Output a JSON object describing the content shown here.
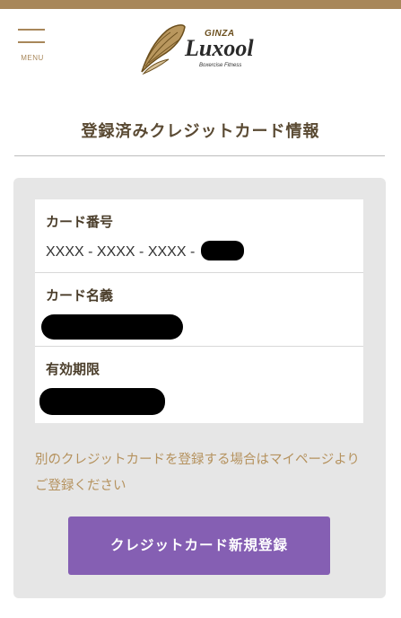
{
  "header": {
    "menu_label": "MENU",
    "logo": {
      "brand_prefix": "GINZA",
      "brand_name": "Luxool",
      "tagline": "Boxercise Fitness"
    }
  },
  "page": {
    "title": "登録済みクレジットカード情報"
  },
  "card_info": {
    "rows": [
      {
        "label": "カード番号",
        "value": "XXXX - XXXX - XXXX - "
      },
      {
        "label": "カード名義",
        "value": ""
      },
      {
        "label": "有効期限",
        "value": ""
      }
    ]
  },
  "notice": {
    "text": "別のクレジットカードを登録する場合はマイページよりご登録ください"
  },
  "actions": {
    "register_label": "クレジットカード新規登録"
  },
  "colors": {
    "accent_gold": "#a8875a",
    "button_purple": "#855fb3",
    "panel_gray": "#e6e6e6",
    "notice_text": "#b5925e"
  }
}
